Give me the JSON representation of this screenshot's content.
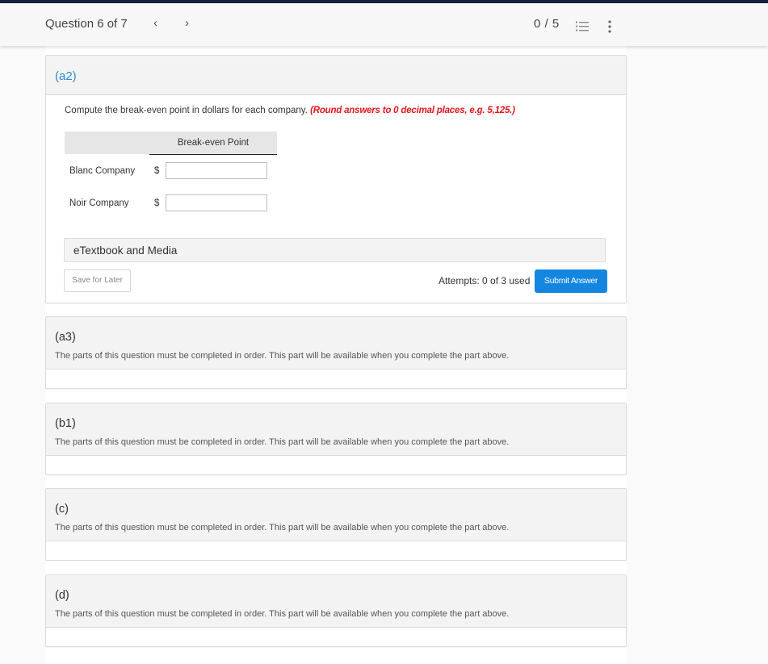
{
  "header": {
    "question_label": "Question 6 of 7",
    "prev_icon": "chevron-left-icon",
    "prev_glyph": "‹",
    "next_icon": "chevron-right-icon",
    "next_glyph": "›",
    "score_label": "0 / 5",
    "list_icon": "numbered-list-icon",
    "more_icon": "more-vertical-icon"
  },
  "part_a2": {
    "label": "(a2)",
    "instruction": "Compute the break-even point in dollars for each company.",
    "hint": "(Round answers to 0 decimal places, e.g. 5,125.)",
    "table": {
      "column_header": "Break-even Point",
      "rows": [
        {
          "label": "Blanc Company",
          "currency": "$",
          "value": ""
        },
        {
          "label": "Noir Company",
          "currency": "$",
          "value": ""
        }
      ]
    },
    "etextbook_label": "eTextbook and Media",
    "save_label": "Save for Later",
    "attempts_label": "Attempts: 0 of 3 used",
    "submit_label": "Submit Answer"
  },
  "locked_parts": [
    {
      "label": "(a3)",
      "message": "The parts of this question must be completed in order. This part will be available when you complete the part above."
    },
    {
      "label": "(b1)",
      "message": "The parts of this question must be completed in order. This part will be available when you complete the part above."
    },
    {
      "label": "(c)",
      "message": "The parts of this question must be completed in order. This part will be available when you complete the part above."
    },
    {
      "label": "(d)",
      "message": "The parts of this question must be completed in order. This part will be available when you complete the part above."
    }
  ],
  "colors": {
    "accent_blue": "#1387df",
    "part_label_blue": "#2a8ad6",
    "hint_red": "#e0161c",
    "top_stripe": "#13203f"
  }
}
